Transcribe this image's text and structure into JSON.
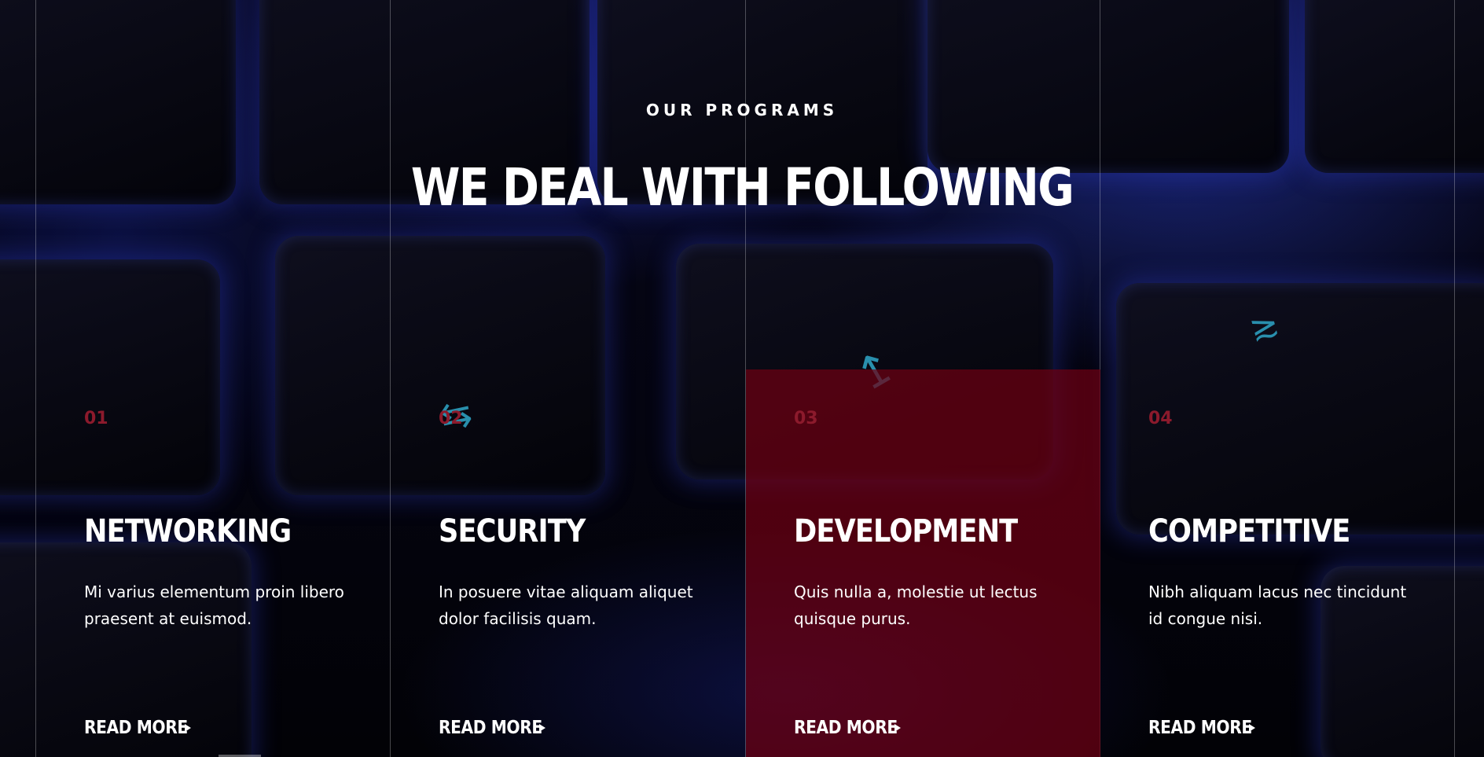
{
  "section": {
    "eyebrow": "OUR PROGRAMS",
    "headline": "WE DEAL WITH FOLLOWING"
  },
  "cards": [
    {
      "number": "01",
      "title": "NETWORKING",
      "text": "Mi varius elementum proin libero praesent at euismod.",
      "link_label": "READ MORE",
      "active": false
    },
    {
      "number": "02",
      "title": "SECURITY",
      "text": "In posuere vitae aliquam aliquet dolor facilisis quam.",
      "link_label": "READ MORE",
      "active": false
    },
    {
      "number": "03",
      "title": "DEVELOPMENT",
      "text": "Quis nulla a, molestie ut lectus quisque purus.",
      "link_label": "READ MORE",
      "active": true
    },
    {
      "number": "04",
      "title": "COMPETITIVE",
      "text": "Nibh aliquam lacus nec tincidunt id congue nisi.",
      "link_label": "READ MORE",
      "active": false
    }
  ],
  "colors": {
    "accent": "#6e0012",
    "number": "#8c1a2c",
    "background": "#050508"
  },
  "icons": {
    "link_arrow": "triangle-right-icon"
  }
}
